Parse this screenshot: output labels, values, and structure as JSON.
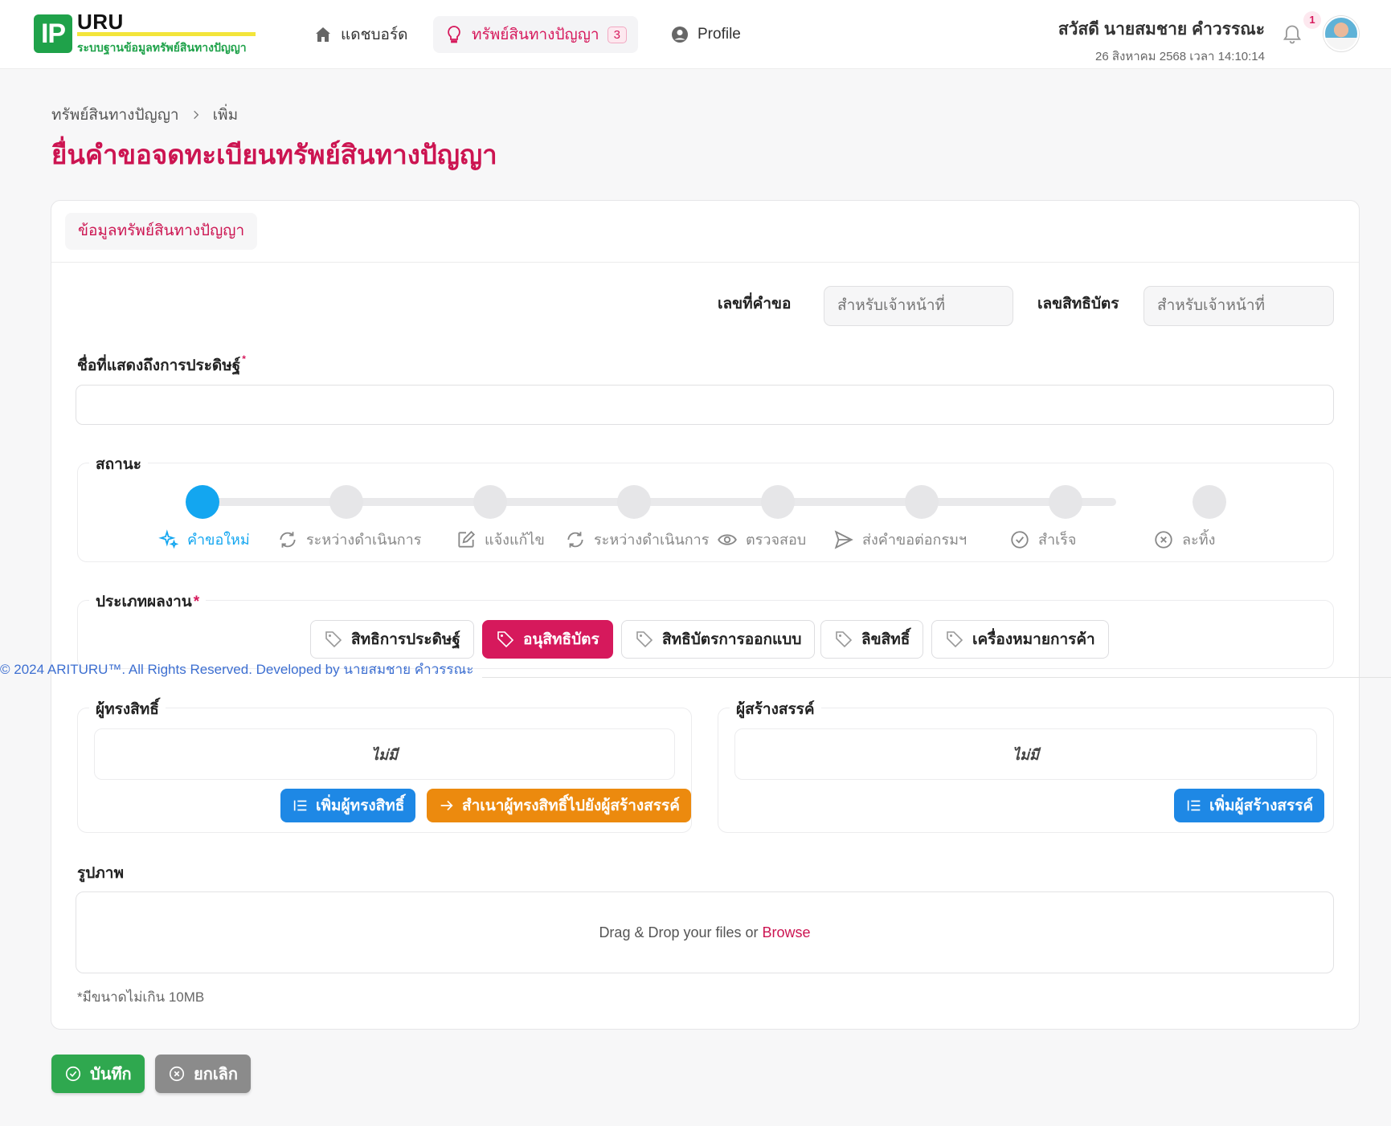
{
  "header": {
    "logo_mark": "IP",
    "logo_name": "URU",
    "logo_subtitle": "ระบบฐานข้อมูลทรัพย์สินทางปัญญา",
    "nav": [
      {
        "label": "แดชบอร์ด",
        "icon": "home-icon"
      },
      {
        "label": "ทรัพย์สินทางปัญญา",
        "icon": "lightbulb-icon",
        "badge": "3",
        "active": true
      },
      {
        "label": "Profile",
        "icon": "user-circle-icon"
      }
    ],
    "greeting": "สวัสดี นายสมชาย คำวรรณะ",
    "datetime": "26 สิงหาคม 2568 เวลา 14:10:14",
    "notification_count": "1"
  },
  "breadcrumb": [
    "ทรัพย์สินทางปัญญา",
    "เพิ่ม"
  ],
  "page_title": "ยื่นคำขอจดทะเบียนทรัพย์สินทางปัญญา",
  "card": {
    "tab_label": "ข้อมูลทรัพย์สินทางปัญญา",
    "request_no_label": "เลขที่คำขอ",
    "request_no_placeholder": "สำหรับเจ้าหน้าที่",
    "patent_no_label": "เลขสิทธิบัตร",
    "patent_no_placeholder": "สำหรับเจ้าหน้าที่",
    "invention_name_label": "ชื่อที่แสดงถึงการประดิษฐ์",
    "invention_name_value": "",
    "required_mark": "*",
    "status": {
      "label": "สถานะ",
      "steps": [
        {
          "label": "คำขอใหม่",
          "icon": "sparkles-icon",
          "active": true
        },
        {
          "label": "ระหว่างดำเนินการ",
          "icon": "refresh-icon"
        },
        {
          "label": "แจ้งแก้ไข",
          "icon": "edit-icon"
        },
        {
          "label": "ระหว่างดำเนินการ",
          "icon": "refresh-icon"
        },
        {
          "label": "ตรวจสอบ",
          "icon": "eye-icon"
        },
        {
          "label": "ส่งคำขอต่อกรมฯ",
          "icon": "send-icon"
        },
        {
          "label": "สำเร็จ",
          "icon": "check-circle-icon"
        },
        {
          "label": "ละทิ้ง",
          "icon": "x-circle-icon"
        }
      ]
    },
    "work_type": {
      "label": "ประเภทผลงาน",
      "options": [
        {
          "label": "สิทธิการประดิษฐ์"
        },
        {
          "label": "อนุสิทธิบัตร",
          "selected": true
        },
        {
          "label": "สิทธิบัตรการออกแบบ"
        },
        {
          "label": "ลิขสิทธิ์"
        },
        {
          "label": "เครื่องหมายการค้า"
        }
      ]
    },
    "owners": {
      "label": "ผู้ทรงสิทธิ์",
      "empty_text": "ไม่มี",
      "add_button": "เพิ่มผู้ทรงสิทธิ์",
      "copy_button": "สำเนาผู้ทรงสิทธิ์ไปยังผู้สร้างสรรค์"
    },
    "creators": {
      "label": "ผู้สร้างสรรค์",
      "empty_text": "ไม่มี",
      "add_button": "เพิ่มผู้สร้างสรรค์"
    },
    "image": {
      "label": "รูปภาพ",
      "drop_text": "Drag & Drop your files or",
      "browse_text": "Browse",
      "note": "*มีขนาดไม่เกิน 10MB"
    }
  },
  "footer_text": "© 2024 ARITURU™. All Rights Reserved. Developed by นายสมชาย คำวรรณะ",
  "actions": {
    "save": "บันทึก",
    "cancel": "ยกเลิก"
  },
  "colors": {
    "brand_green": "#1fa24a",
    "accent_pink": "#d6195c",
    "step_active": "#13a6f0",
    "button_blue": "#1e88e5",
    "button_orange": "#ec8a0e"
  }
}
